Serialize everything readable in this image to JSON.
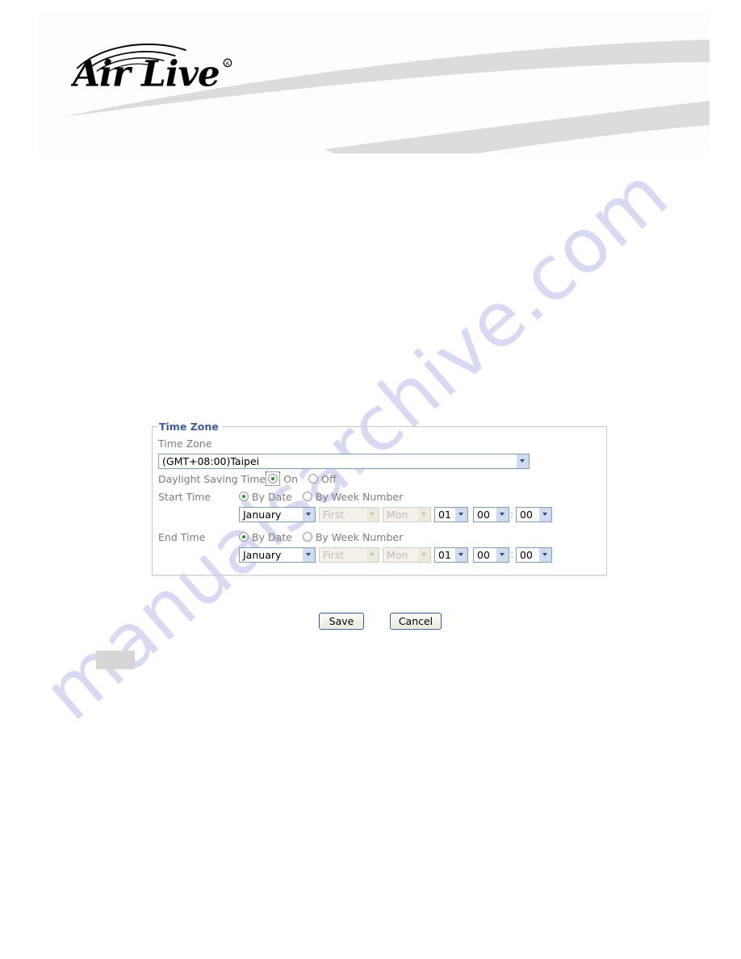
{
  "document": {
    "brand": "AirLive",
    "brand_trademark": "®",
    "watermark": "manualsarchive.com"
  },
  "form": {
    "legend": "Time Zone",
    "timezone": {
      "label": "Time Zone",
      "value": "(GMT+08:00)Taipei"
    },
    "daylight_saving": {
      "label": "Daylight Saving Time",
      "on_label": "On",
      "off_label": "Off",
      "selected": "On"
    },
    "start_time": {
      "label": "Start Time",
      "mode_by_date_label": "By Date",
      "mode_by_week_label": "By Week Number",
      "mode_selected": "By Date",
      "month": "January",
      "week": "First",
      "weekday": "Mon",
      "day": "01",
      "hour": "00",
      "minute": "00",
      "time_separator": ":"
    },
    "end_time": {
      "label": "End Time",
      "mode_by_date_label": "By Date",
      "mode_by_week_label": "By Week Number",
      "mode_selected": "By Date",
      "month": "January",
      "week": "First",
      "weekday": "Mon",
      "day": "01",
      "hour": "00",
      "minute": "00",
      "time_separator": ":"
    }
  },
  "actions": {
    "save_label": "Save",
    "cancel_label": "Cancel"
  },
  "colors": {
    "legend_blue": "#3d5a9e",
    "label_gray": "#7c7c7c",
    "select_border": "#7f9db9",
    "arrow_fill": "#cfdcf0",
    "radio_dot_green": "#2e8b2e",
    "button_border": "#2f5c94",
    "fieldset_border": "#c6c6c6",
    "swoosh_gray": "#dcdcdc",
    "watermark_lavender": "#d9d9f3",
    "redaction_gray": "#d6d6d6"
  }
}
